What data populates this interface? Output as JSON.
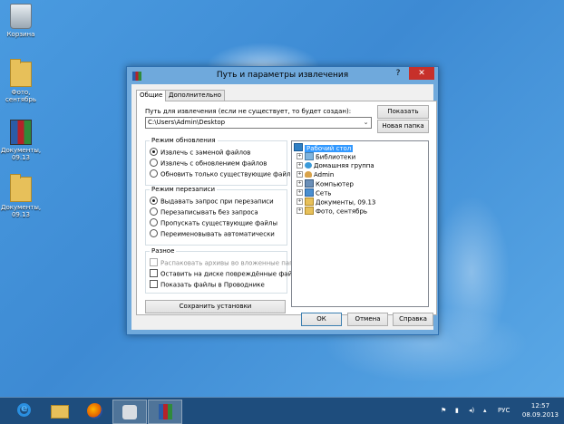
{
  "desktop": {
    "icons": [
      {
        "label": "Корзина",
        "icon": "recycle-bin-icon"
      },
      {
        "label": "Фото, сентябрь",
        "icon": "folder-icon"
      },
      {
        "label": "Документы, 09.13",
        "icon": "winrar-archive-icon"
      },
      {
        "label": "Документы, 09.13",
        "icon": "folder-icon"
      }
    ]
  },
  "dialog": {
    "title": "Путь и параметры извлечения",
    "help": "?",
    "close": "✕",
    "tabs": [
      "Общие",
      "Дополнительно"
    ],
    "path_label": "Путь для извлечения (если не существует, то будет создан):",
    "path_value": "C:\\Users\\Admin\\Desktop",
    "show_button": "Показать",
    "new_folder_button": "Новая папка",
    "update_mode": {
      "title": "Режим обновления",
      "options": [
        "Извлечь с заменой файлов",
        "Извлечь с обновлением файлов",
        "Обновить только существующие файлы"
      ],
      "selected": 0
    },
    "overwrite_mode": {
      "title": "Режим перезаписи",
      "options": [
        "Выдавать запрос при перезаписи",
        "Перезаписывать без запроса",
        "Пропускать существующие файлы",
        "Переименовывать автоматически"
      ],
      "selected": 0
    },
    "misc": {
      "title": "Разное",
      "options": [
        {
          "label": "Распаковать архивы во вложенные папки",
          "disabled": true
        },
        {
          "label": "Оставить на диске повреждённые файлы",
          "disabled": false
        },
        {
          "label": "Показать файлы в Проводнике",
          "disabled": false
        }
      ]
    },
    "save_settings_button": "Сохранить установки",
    "tree": [
      {
        "label": "Рабочий стол",
        "icon": "desktop-icon",
        "level": 0,
        "selected": true,
        "expandable": false
      },
      {
        "label": "Библиотеки",
        "icon": "library-icon",
        "level": 1,
        "expandable": true
      },
      {
        "label": "Домашняя группа",
        "icon": "homegroup-icon",
        "level": 1,
        "expandable": true
      },
      {
        "label": "Admin",
        "icon": "user-icon",
        "level": 1,
        "expandable": true
      },
      {
        "label": "Компьютер",
        "icon": "computer-icon",
        "level": 1,
        "expandable": true
      },
      {
        "label": "Сеть",
        "icon": "network-icon",
        "level": 1,
        "expandable": true
      },
      {
        "label": "Документы, 09.13",
        "icon": "folder-icon",
        "level": 1,
        "expandable": true
      },
      {
        "label": "Фото, сентябрь",
        "icon": "folder-icon",
        "level": 1,
        "expandable": true
      }
    ],
    "ok_button": "ОК",
    "cancel_button": "Отмена",
    "help_button": "Справка"
  },
  "taskbar": {
    "apps": [
      "internet-explorer-icon",
      "file-explorer-icon",
      "firefox-icon",
      "tool-icon",
      "winrar-icon"
    ],
    "language": "РУС",
    "time": "12:57",
    "date": "08.09.2013"
  }
}
